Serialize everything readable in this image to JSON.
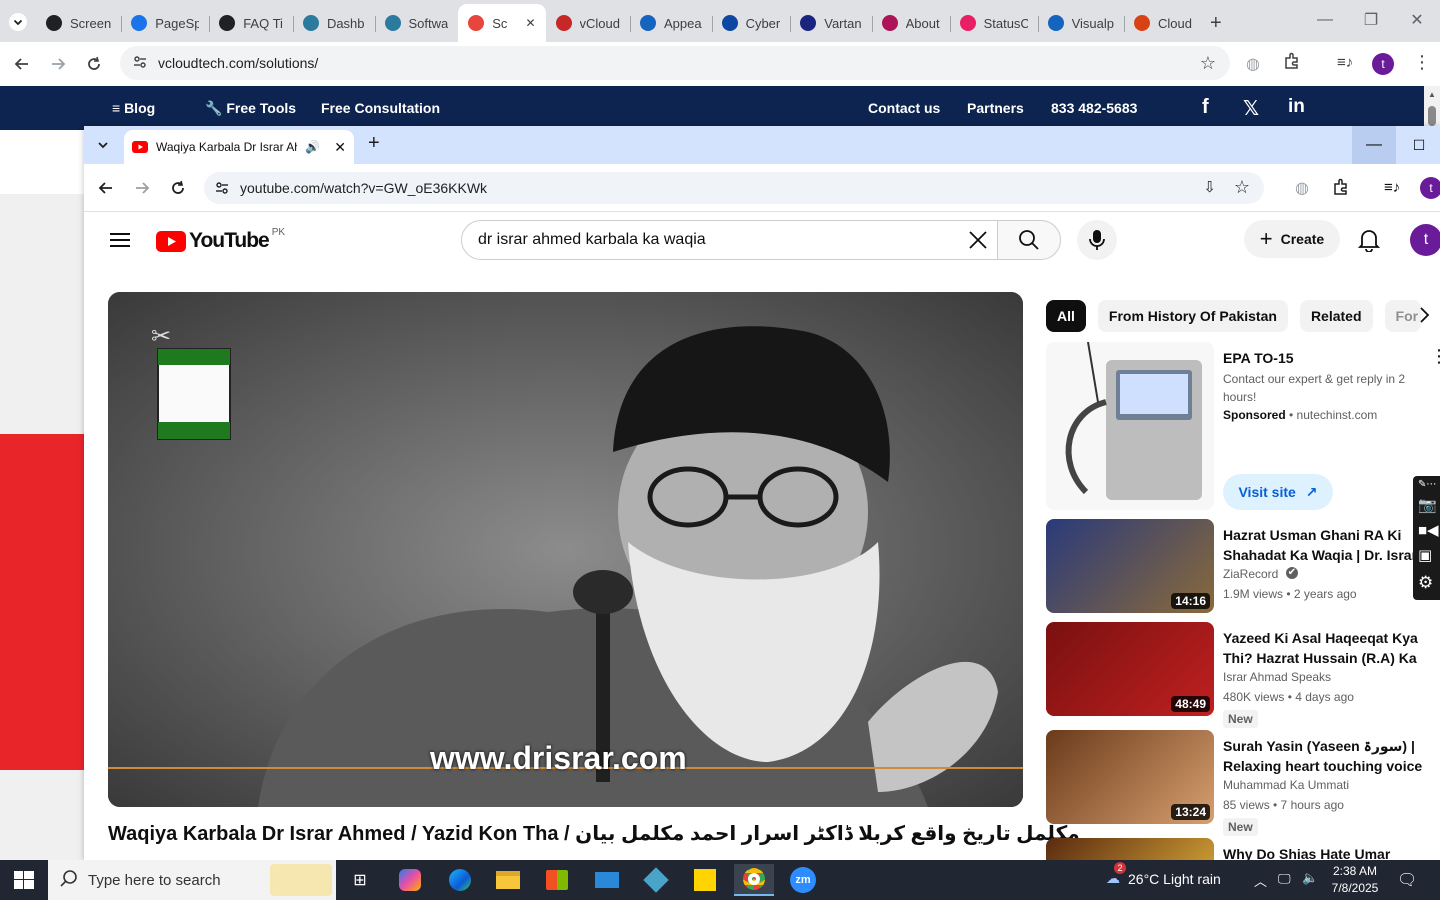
{
  "outer_browser": {
    "tabs": [
      {
        "label": "Screen",
        "color": "#202124"
      },
      {
        "label": "PageSp",
        "color": "#1a73e8"
      },
      {
        "label": "FAQ Ti",
        "color": "#202124"
      },
      {
        "label": "Dashb",
        "color": "#2c7a9e"
      },
      {
        "label": "Softwa",
        "color": "#2c7a9e"
      },
      {
        "label": "Sc",
        "color": "#e8453c",
        "active": true
      },
      {
        "label": "vCloud",
        "color": "#c62828"
      },
      {
        "label": "Appea",
        "color": "#1565c0"
      },
      {
        "label": "Cyber",
        "color": "#0d47a1"
      },
      {
        "label": "Vartan",
        "color": "#1a237e"
      },
      {
        "label": "About",
        "color": "#ad1457"
      },
      {
        "label": "StatusC",
        "color": "#e91e63"
      },
      {
        "label": "Visualp",
        "color": "#1565c0"
      },
      {
        "label": "Cloud",
        "color": "#d84315"
      }
    ],
    "url": "vcloudtech.com/solutions/",
    "profile_initial": "t"
  },
  "site_nav": {
    "blog": "Blog",
    "free_tools": "Free Tools",
    "free_consultation": "Free Consultation",
    "contact": "Contact us",
    "partners": "Partners",
    "phone": "833 482-5683"
  },
  "inner_browser": {
    "tab_title": "Waqiya Karbala Dr Israr Ah",
    "url": "youtube.com/watch?v=GW_oE36KKWk",
    "profile_initial": "t"
  },
  "youtube": {
    "logo_text": "YouTube",
    "country": "PK",
    "search_value": "dr israr ahmed karbala ka waqia",
    "create_label": "Create",
    "avatar_initial": "t",
    "video_watermark": "www.drisrar.com",
    "video_title": "Waqiya Karbala Dr Israr Ahmed / Yazid Kon Tha / مکلمل تاریخ واقع کربلا ڈاکٹر اسرار احمد مکلمل بیان",
    "chips": [
      "All",
      "From History Of Pakistan",
      "Related",
      "For"
    ],
    "ad": {
      "title": "EPA TO-15",
      "description": "Contact our expert & get reply in 2 hours!",
      "sponsored": "Sponsored",
      "domain": "nutechinst.com",
      "cta": "Visit site"
    },
    "recommendations": [
      {
        "title": "Hazrat Usman Ghani RA Ki Shahadat Ka Waqia | Dr. Israr ...",
        "channel": "ZiaRecord",
        "meta": "1.9M views • 2 years ago",
        "duration": "14:16",
        "new": ""
      },
      {
        "title": "Yazeed Ki Asal Haqeeqat Kya Thi? Hazrat Hussain (R.A) Ka ...",
        "channel": "Israr Ahmad Speaks",
        "meta": "480K views • 4 days ago",
        "duration": "48:49",
        "new": "New"
      },
      {
        "title": "Surah Yasin (Yaseen سورۃ) | Relaxing heart  touching voice ...",
        "channel": "Muhammad Ka Ummati",
        "meta": "85 views • 7 hours ago",
        "duration": "13:24",
        "new": "New"
      },
      {
        "title": "Why Do Shias Hate Umar (RA)? |",
        "channel": "",
        "meta": "",
        "duration": "",
        "new": ""
      }
    ]
  },
  "taskbar": {
    "search_placeholder": "Type here to search",
    "weather": "26°C  Light rain",
    "weather_badge": "2",
    "time": "2:38 AM",
    "date": "7/8/2025"
  }
}
